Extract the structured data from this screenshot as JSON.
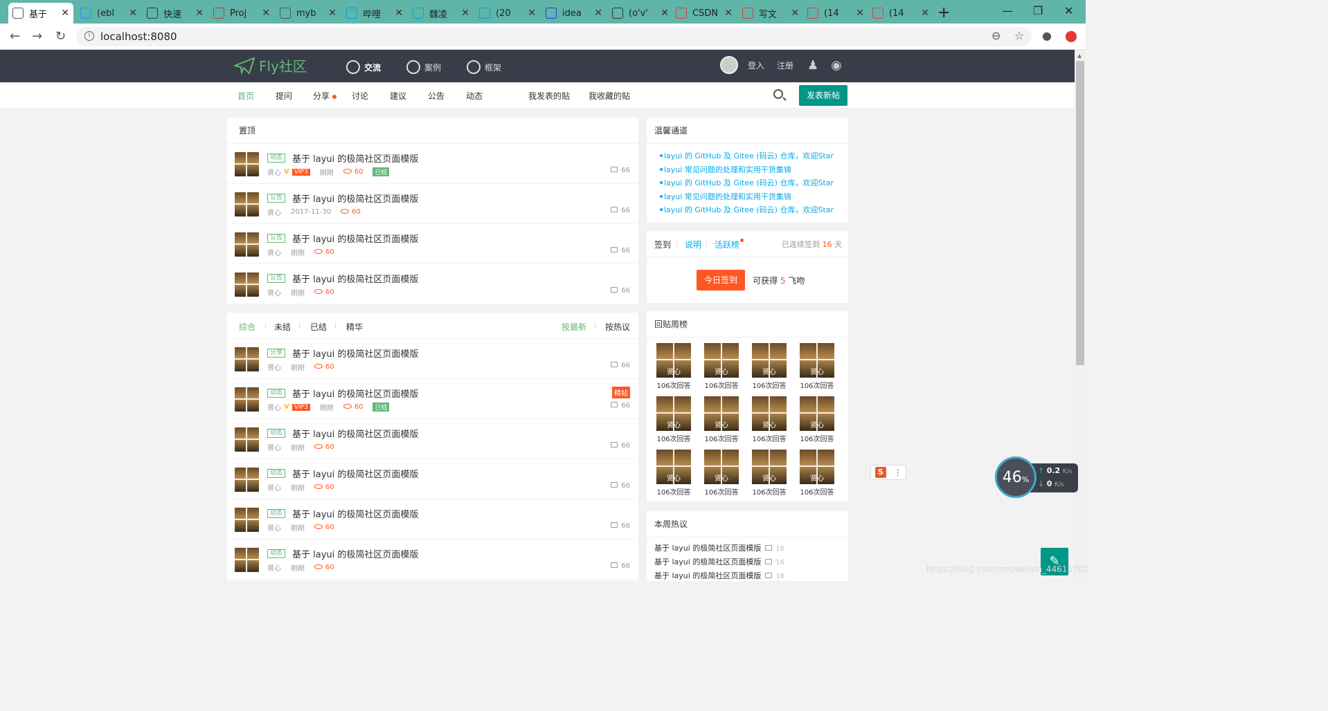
{
  "browser": {
    "tabs": [
      {
        "title": "基于",
        "icon": "doc-icon",
        "active": true
      },
      {
        "title": "(ebl",
        "icon": "ma-icon",
        "active": false
      },
      {
        "title": "快速",
        "icon": "bird-icon",
        "active": false
      },
      {
        "title": "Proj",
        "icon": "leaf-icon",
        "active": false
      },
      {
        "title": "myb",
        "icon": "doc-icon",
        "active": false
      },
      {
        "title": "哔哩",
        "icon": "bilibili-icon",
        "active": false
      },
      {
        "title": "魏凌",
        "icon": "bilibili-icon",
        "active": false
      },
      {
        "title": "(20",
        "icon": "bilibili-icon",
        "active": false
      },
      {
        "title": "idea",
        "icon": "baidu-icon",
        "active": false
      },
      {
        "title": "(o'v'",
        "icon": "tiger-icon",
        "active": false
      },
      {
        "title": "CSDN",
        "icon": "csdn-icon",
        "active": false
      },
      {
        "title": "写文",
        "icon": "csdn-icon",
        "active": false
      },
      {
        "title": "(14",
        "icon": "csdn-icon",
        "active": false
      },
      {
        "title": "(14",
        "icon": "csdn-icon",
        "active": false
      }
    ],
    "url": "localhost:8080"
  },
  "header": {
    "logo_text": "Fly社区",
    "nav": [
      {
        "label": "交流",
        "active": true
      },
      {
        "label": "案例",
        "active": false
      },
      {
        "label": "框架",
        "active": false
      }
    ],
    "login": "登入",
    "register": "注册"
  },
  "subnav": {
    "items": [
      "首页",
      "提问",
      "分享",
      "讨论",
      "建议",
      "公告",
      "动态"
    ],
    "my_posts": "我发表的贴",
    "my_favorites": "我收藏的贴",
    "post_button": "发表新帖"
  },
  "sticky": {
    "title": "置顶",
    "items": [
      {
        "badge": "动态",
        "title": "基于 layui 的极简社区页面模版",
        "author": "贤心",
        "vip": "VIP3",
        "time": "刚刚",
        "views": "60",
        "status": "已结",
        "comments": "66"
      },
      {
        "badge": "公告",
        "title": "基于 layui 的极简社区页面模版",
        "author": "贤心",
        "time": "2017-11-30",
        "views": "60",
        "comments": "66"
      },
      {
        "badge": "公告",
        "title": "基于 layui 的极简社区页面模版",
        "author": "贤心",
        "time": "刚刚",
        "views": "60",
        "comments": "66"
      },
      {
        "badge": "公告",
        "title": "基于 layui 的极简社区页面模版",
        "author": "贤心",
        "time": "刚刚",
        "views": "60",
        "comments": "66"
      }
    ]
  },
  "list": {
    "filters": [
      "综合",
      "未结",
      "已结",
      "精华"
    ],
    "sort_new": "按最新",
    "sort_hot": "按热议",
    "items": [
      {
        "badge": "分享",
        "title": "基于 layui 的极简社区页面模版",
        "author": "贤心",
        "time": "刚刚",
        "views": "60",
        "comments": "66"
      },
      {
        "badge": "动态",
        "title": "基于 layui 的极简社区页面模版",
        "author": "贤心",
        "vip": "VIP3",
        "time": "刚刚",
        "views": "60",
        "status": "已结",
        "tag": "精帖",
        "comments": "66"
      },
      {
        "badge": "动态",
        "title": "基于 layui 的极简社区页面模版",
        "author": "贤心",
        "time": "刚刚",
        "views": "60",
        "comments": "66"
      },
      {
        "badge": "动态",
        "title": "基于 layui 的极简社区页面模版",
        "author": "贤心",
        "time": "刚刚",
        "views": "60",
        "comments": "66"
      },
      {
        "badge": "动态",
        "title": "基于 layui 的极简社区页面模版",
        "author": "贤心",
        "time": "刚刚",
        "views": "60",
        "comments": "66"
      },
      {
        "badge": "动态",
        "title": "基于 layui 的极简社区页面模版",
        "author": "贤心",
        "time": "刚刚",
        "views": "60",
        "comments": "66"
      }
    ]
  },
  "sidebar": {
    "channel_title": "温馨通道",
    "links": [
      "layui 的 GitHub 及 Gitee (码云) 仓库，欢迎Star",
      "layui 常见问题的处理和实用干货集锦",
      "layui 的 GitHub 及 Gitee (码云) 仓库，欢迎Star",
      "layui 常见问题的处理和实用干货集锦",
      "layui 的 GitHub 及 Gitee (码云) 仓库，欢迎Star"
    ],
    "sign": {
      "tab_sign": "签到",
      "tab_help": "说明",
      "tab_rank": "活跃榜",
      "streak_prefix": "已连续签到",
      "streak_days": "16",
      "streak_suffix": "天",
      "button": "今日签到",
      "gain_prefix": "可获得",
      "gain_value": "5",
      "gain_suffix": "飞吻"
    },
    "ranking_title": "回贴周榜",
    "ranking": [
      {
        "name": "贤心",
        "count": "106次回答"
      },
      {
        "name": "贤心",
        "count": "106次回答"
      },
      {
        "name": "贤心",
        "count": "106次回答"
      },
      {
        "name": "贤心",
        "count": "106次回答"
      },
      {
        "name": "贤心",
        "count": "106次回答"
      },
      {
        "name": "贤心",
        "count": "106次回答"
      },
      {
        "name": "贤心",
        "count": "106次回答"
      },
      {
        "name": "贤心",
        "count": "106次回答"
      },
      {
        "name": "贤心",
        "count": "106次回答"
      },
      {
        "name": "贤心",
        "count": "106次回答"
      },
      {
        "name": "贤心",
        "count": "106次回答"
      },
      {
        "name": "贤心",
        "count": "106次回答"
      }
    ],
    "hot_title": "本周热议",
    "hot": [
      {
        "title": "基于 layui 的极简社区页面模版",
        "count": "16"
      },
      {
        "title": "基于 layui 的极简社区页面模版",
        "count": "16"
      },
      {
        "title": "基于 layui 的极简社区页面模版",
        "count": "16"
      }
    ]
  },
  "overlay": {
    "netspeed_percent": "46",
    "percent_sign": "%",
    "upload": "0.2",
    "download": "0",
    "unit": "K/s",
    "watermark": "https://blog.csdn.net/weixin_44611702"
  },
  "colors": {
    "accent": "#009688",
    "green": "#5fb878",
    "orange": "#ff5722",
    "header": "#393d49",
    "link": "#01aaed"
  }
}
